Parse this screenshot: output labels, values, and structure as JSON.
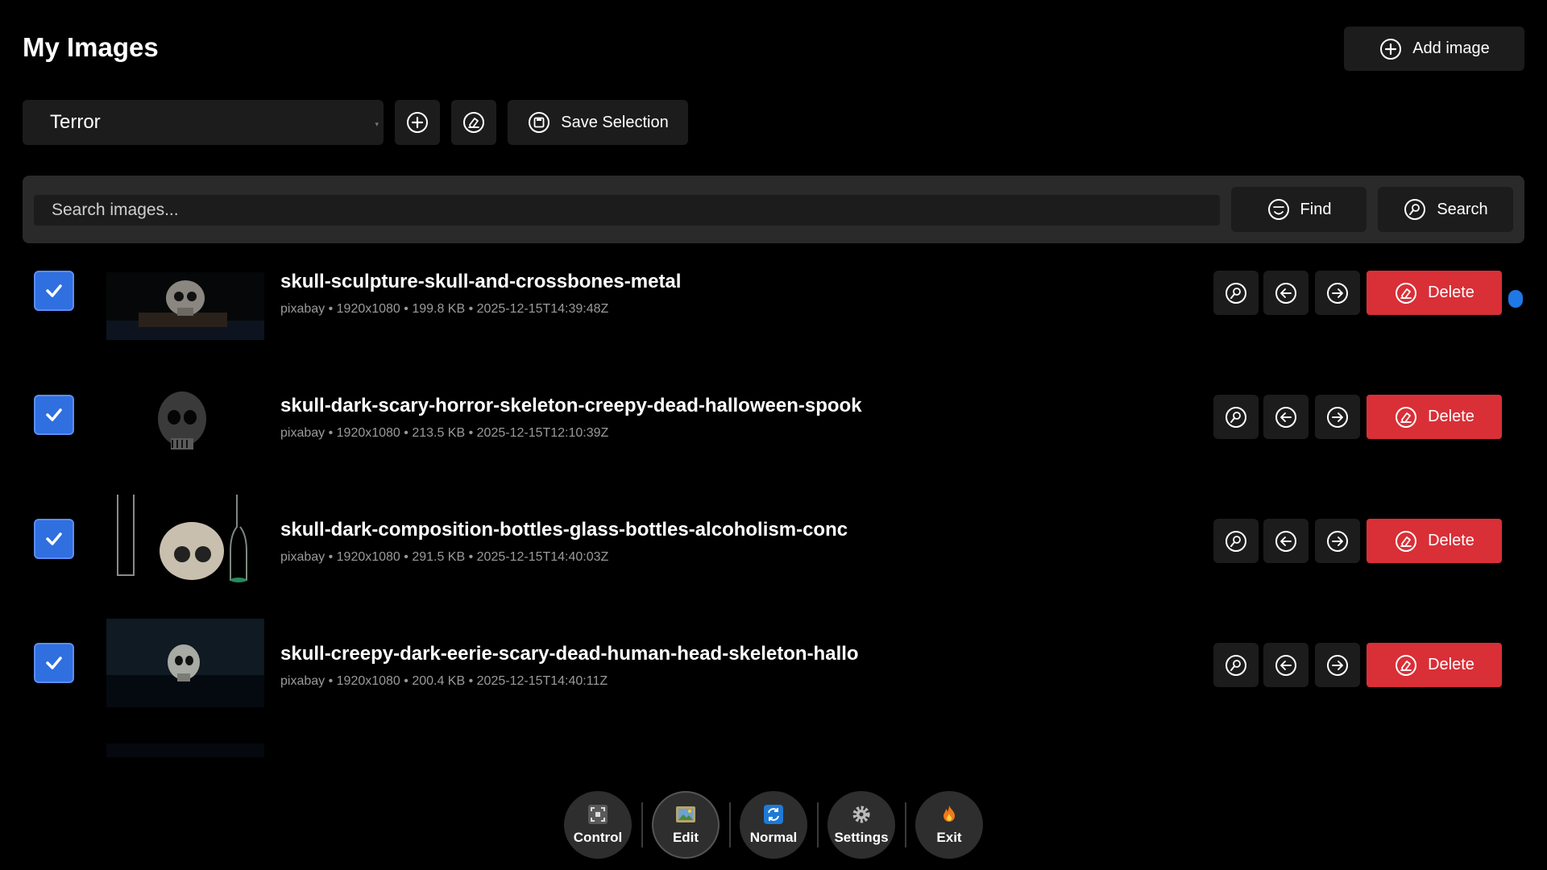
{
  "header": {
    "title": "My Images",
    "add_image_label": "Add image"
  },
  "selection": {
    "current_collection": "Terror",
    "save_label": "Save Selection"
  },
  "search": {
    "placeholder": "Search images...",
    "find_label": "Find",
    "search_label": "Search"
  },
  "images": [
    {
      "title": "skull-sculpture-skull-and-crossbones-metal",
      "meta": "pixabay • 1920x1080 • 199.8 KB • 2025-12-15T14:39:48Z",
      "checked": true,
      "delete_label": "Delete"
    },
    {
      "title": "skull-dark-scary-horror-skeleton-creepy-dead-halloween-spook",
      "meta": "pixabay • 1920x1080 • 213.5 KB • 2025-12-15T12:10:39Z",
      "checked": true,
      "delete_label": "Delete"
    },
    {
      "title": "skull-dark-composition-bottles-glass-bottles-alcoholism-conc",
      "meta": "pixabay • 1920x1080 • 291.5 KB • 2025-12-15T14:40:03Z",
      "checked": true,
      "delete_label": "Delete"
    },
    {
      "title": "skull-creepy-dark-eerie-scary-dead-human-head-skeleton-hallo",
      "meta": "pixabay • 1920x1080 • 200.4 KB • 2025-12-15T14:40:11Z",
      "checked": true,
      "delete_label": "Delete"
    }
  ],
  "dock": {
    "control": "Control",
    "edit": "Edit",
    "normal": "Normal",
    "settings": "Settings",
    "exit": "Exit"
  },
  "colors": {
    "accent": "#2f6fe0",
    "danger": "#d92f37",
    "surface": "#1c1c1c",
    "panel": "#2a2a2a"
  }
}
